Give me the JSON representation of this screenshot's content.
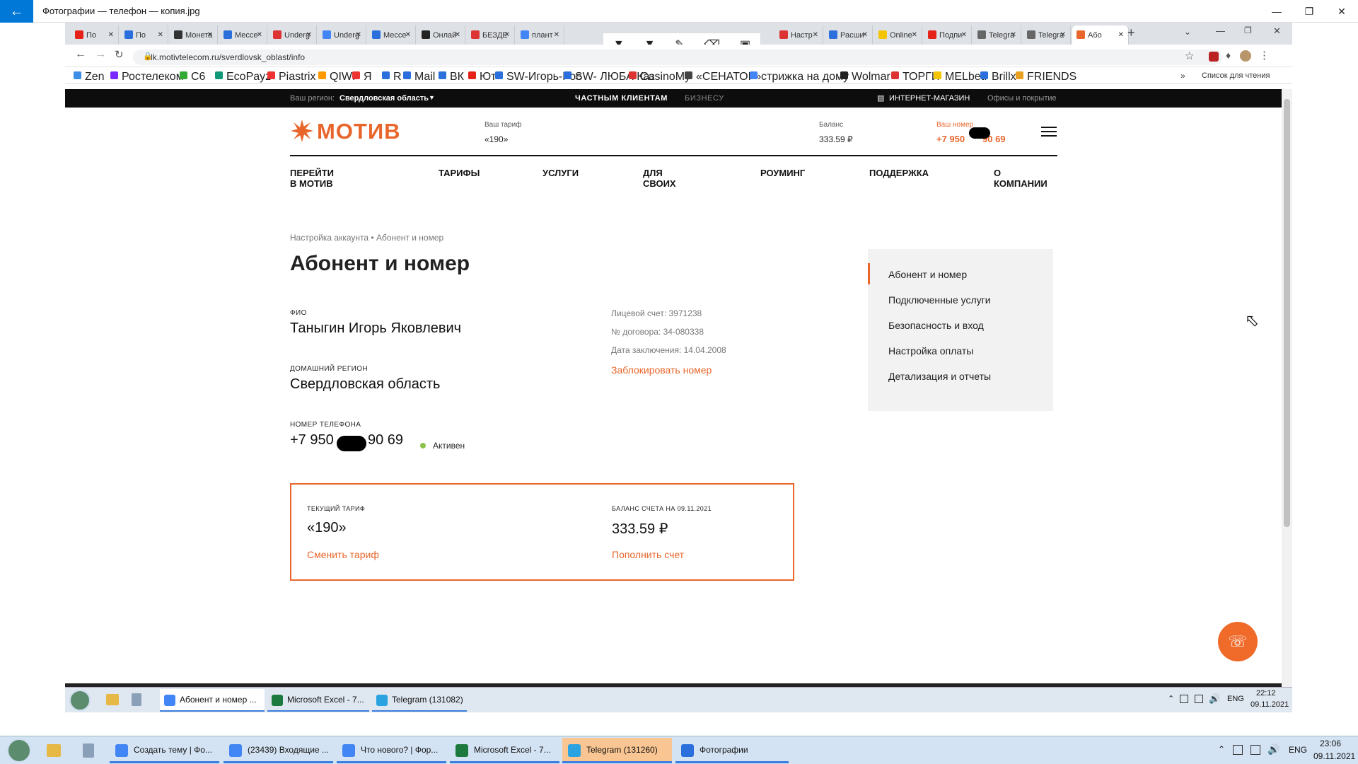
{
  "photos_window": {
    "title": "Фотографии — телефон — копия.jpg",
    "back_icon": "arrow-left-icon",
    "controls": [
      "minimize-icon",
      "restore-icon",
      "close-icon"
    ]
  },
  "browser": {
    "tabs": [
      {
        "label": "По",
        "color": "#e62117"
      },
      {
        "label": "По",
        "color": "#2a6fdb"
      },
      {
        "label": "Монета",
        "color": "#333"
      },
      {
        "label": "Мессе",
        "color": "#2a6fdb"
      },
      {
        "label": "Underg",
        "color": "#d33"
      },
      {
        "label": "Underg",
        "color": "#4285f4"
      },
      {
        "label": "Мессе",
        "color": "#2a6fdb"
      },
      {
        "label": "Онлай",
        "color": "#222"
      },
      {
        "label": "БЕЗДЕ",
        "color": "#d33"
      },
      {
        "label": "плант",
        "color": "#4285f4"
      },
      {
        "label": "Настр",
        "color": "#d33"
      },
      {
        "label": "Расши",
        "color": "#2a6fdb"
      },
      {
        "label": "Online",
        "color": "#f5c400"
      },
      {
        "label": "Подпи",
        "color": "#e62117"
      },
      {
        "label": "Telegra",
        "color": "#666"
      },
      {
        "label": "Telegra",
        "color": "#666"
      },
      {
        "label": "Або",
        "color": "#e8662b",
        "active": true
      }
    ],
    "url": "lk.motivtelecom.ru/sverdlovsk_oblast/info",
    "bookmarks": [
      {
        "label": "Zen",
        "color": "#3c8ee6"
      },
      {
        "label": "Ростелеком",
        "color": "#7b2aff"
      },
      {
        "label": "C6",
        "color": "#3a3"
      },
      {
        "label": "EcoPayz",
        "color": "#197"
      },
      {
        "label": "Piastrix",
        "color": "#e33"
      },
      {
        "label": "QIWI",
        "color": "#f90"
      },
      {
        "label": "Я",
        "color": "#e33"
      },
      {
        "label": "R",
        "color": "#2a6fdb"
      },
      {
        "label": "Mail",
        "color": "#2a6fdb"
      },
      {
        "label": "ВК",
        "color": "#2a6fdb"
      },
      {
        "label": "Ют",
        "color": "#e62117"
      },
      {
        "label": "SW-Игорь-Рос",
        "color": "#2a6fdb"
      },
      {
        "label": "SW- ЛЮБА Каз",
        "color": "#2a6fdb"
      },
      {
        "label": "CasinoMy",
        "color": "#d33"
      },
      {
        "label": "«СЕНАТОР»",
        "color": "#444"
      },
      {
        "label": "стрижка на дому",
        "color": "#4285f4"
      },
      {
        "label": "Wolmar",
        "color": "#222"
      },
      {
        "label": "ТОРГИ",
        "color": "#d33"
      },
      {
        "label": "MELbet.",
        "color": "#f5c400"
      },
      {
        "label": "Brillx",
        "color": "#2a6fdb"
      },
      {
        "label": "FRIENDS",
        "color": "#e8a020"
      }
    ],
    "reading_list": "Список для чтения"
  },
  "site": {
    "region_label": "Ваш регион:",
    "region_value": "Свердловская область",
    "segment_private": "ЧАСТНЫМ КЛИЕНТАМ",
    "segment_business": "БИЗНЕСУ",
    "shop": "ИНТЕРНЕТ-МАГАЗИН",
    "offices": "Офисы и покрытие",
    "logo": "МОТИВ",
    "tariff_label": "Ваш тариф",
    "tariff_value": "«190»",
    "balance_label": "Баланс",
    "balance_value": "333.59 ₽",
    "number_label": "Ваш номер",
    "number_left": "+7 950",
    "number_right": "90 69",
    "nav": [
      "ПЕРЕЙТИ В МОТИВ",
      "ТАРИФЫ",
      "УСЛУГИ",
      "ДЛЯ СВОИХ",
      "РОУМИНГ",
      "ПОДДЕРЖКА",
      "О КОМПАНИИ"
    ],
    "breadcrumb_1": "Настройка аккаунта",
    "breadcrumb_sep": "•",
    "breadcrumb_2": "Абонент и номер",
    "page_title": "Абонент и номер",
    "fio_label": "ФИО",
    "fio_value": "Таныгин Игорь Яковлевич",
    "region_home_label": "ДОМАШНИЙ РЕГИОН",
    "region_home_value": "Свердловская область",
    "phone_label": "НОМЕР ТЕЛЕФОНА",
    "phone_left": "+7 950",
    "phone_right": "90 69",
    "status": "Активен",
    "account": "Лицевой счет: 3971238",
    "contract": "№ договора: 34-080338",
    "date": "Дата заключения: 14.04.2008",
    "block_link": "Заблокировать номер",
    "current_tariff_label": "ТЕКУЩИЙ ТАРИФ",
    "current_tariff_value": "«190»",
    "change_tariff": "Сменить тариф",
    "balance_box_label": "БАЛАНС СЧЕТА НА 09.11.2021",
    "balance_box_value": "333.59 ₽",
    "topup": "Пополнить счет",
    "side_menu": [
      "Абонент и номер",
      "Подключенные услуги",
      "Безопасность и вход",
      "Настройка оплаты",
      "Детализация и отчеты"
    ],
    "accent": "#e8662b"
  },
  "inner_taskbar": {
    "items": [
      {
        "label": "Абонент и номер ...",
        "color": "#4285f4"
      },
      {
        "label": "Microsoft Excel - 7...",
        "color": "#1d7a3e"
      },
      {
        "label": "Telegram (131082)",
        "color": "#2aa3e0"
      }
    ],
    "lang": "ENG",
    "time": "22:12",
    "date": "09.11.2021"
  },
  "outer_taskbar": {
    "items": [
      {
        "label": "Создать тему | Фо...",
        "color": "#4285f4"
      },
      {
        "label": "(23439) Входящие ...",
        "color": "#4285f4"
      },
      {
        "label": "Что нового? | Фор...",
        "color": "#4285f4"
      },
      {
        "label": "Microsoft Excel - 7...",
        "color": "#1d7a3e"
      },
      {
        "label": "Telegram (131260)",
        "color": "#2aa3e0"
      },
      {
        "label": "Фотографии",
        "color": "#2a6fdb"
      }
    ],
    "lang": "ENG",
    "time": "23:06",
    "date": "09.11.2021"
  }
}
